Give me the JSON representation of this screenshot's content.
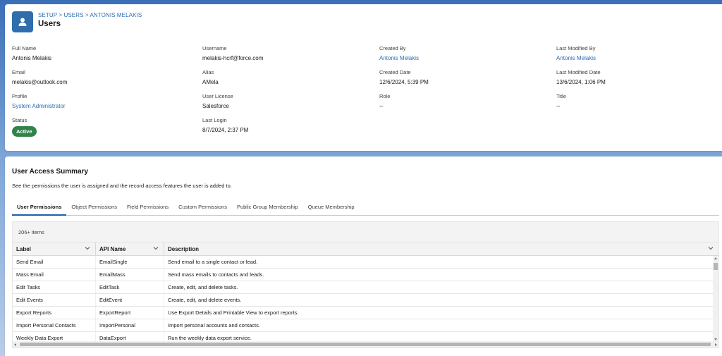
{
  "header": {
    "breadcrumb": "SETUP > USERS > ANTONIS MELAKIS",
    "title": "Users",
    "icon": "user-icon"
  },
  "fields": {
    "full_name": {
      "label": "Full Name",
      "value": "Antonis Melakis"
    },
    "username": {
      "label": "Username",
      "value": "melakis-hcrf@force.com"
    },
    "created_by": {
      "label": "Created By",
      "value": "Antonis Melakis"
    },
    "last_modified_by": {
      "label": "Last Modified By",
      "value": "Antonis Melakis"
    },
    "email": {
      "label": "Email",
      "value": "melakis@outlook.com"
    },
    "alias": {
      "label": "Alias",
      "value": "AMela"
    },
    "created_date": {
      "label": "Created Date",
      "value": "12/6/2024, 5:39 PM"
    },
    "last_modified_date": {
      "label": "Last Modified Date",
      "value": "13/6/2024, 1:06 PM"
    },
    "profile": {
      "label": "Profile",
      "value": "System Administrator"
    },
    "user_license": {
      "label": "User License",
      "value": "Salesforce"
    },
    "role": {
      "label": "Role",
      "value": "--"
    },
    "title": {
      "label": "Title",
      "value": "--"
    },
    "status": {
      "label": "Status",
      "value": "Active"
    },
    "last_login": {
      "label": "Last Login",
      "value": "8/7/2024, 2:37 PM"
    }
  },
  "summary": {
    "title": "User Access Summary",
    "description": "See the permissions the user is assigned and the record access features the user is added to.",
    "tabs": [
      "User Permissions",
      "Object Permissions",
      "Field Permissions",
      "Custom Permissions",
      "Public Group Membership",
      "Queue Membership"
    ],
    "active_tab": "User Permissions"
  },
  "table": {
    "item_count": "206+ items",
    "columns": [
      "Label",
      "API Name",
      "Description"
    ],
    "rows": [
      [
        "Send Email",
        "EmailSingle",
        "Send email to a single contact or lead."
      ],
      [
        "Mass Email",
        "EmailMass",
        "Send mass emails to contacts and leads."
      ],
      [
        "Edit Tasks",
        "EditTask",
        "Create, edit, and delete tasks."
      ],
      [
        "Edit Events",
        "EditEvent",
        "Create, edit, and delete events."
      ],
      [
        "Export Reports",
        "ExportReport",
        "Use Export Details and Printable View to export reports."
      ],
      [
        "Import Personal Contacts",
        "ImportPersonal",
        "Import personal accounts and contacts."
      ],
      [
        "Weekly Data Export",
        "DataExport",
        "Run the weekly data export service."
      ]
    ]
  },
  "colors": {
    "link": "#2f6db3",
    "status_active": "#2e844a",
    "icon_bg": "#2f6dad"
  }
}
